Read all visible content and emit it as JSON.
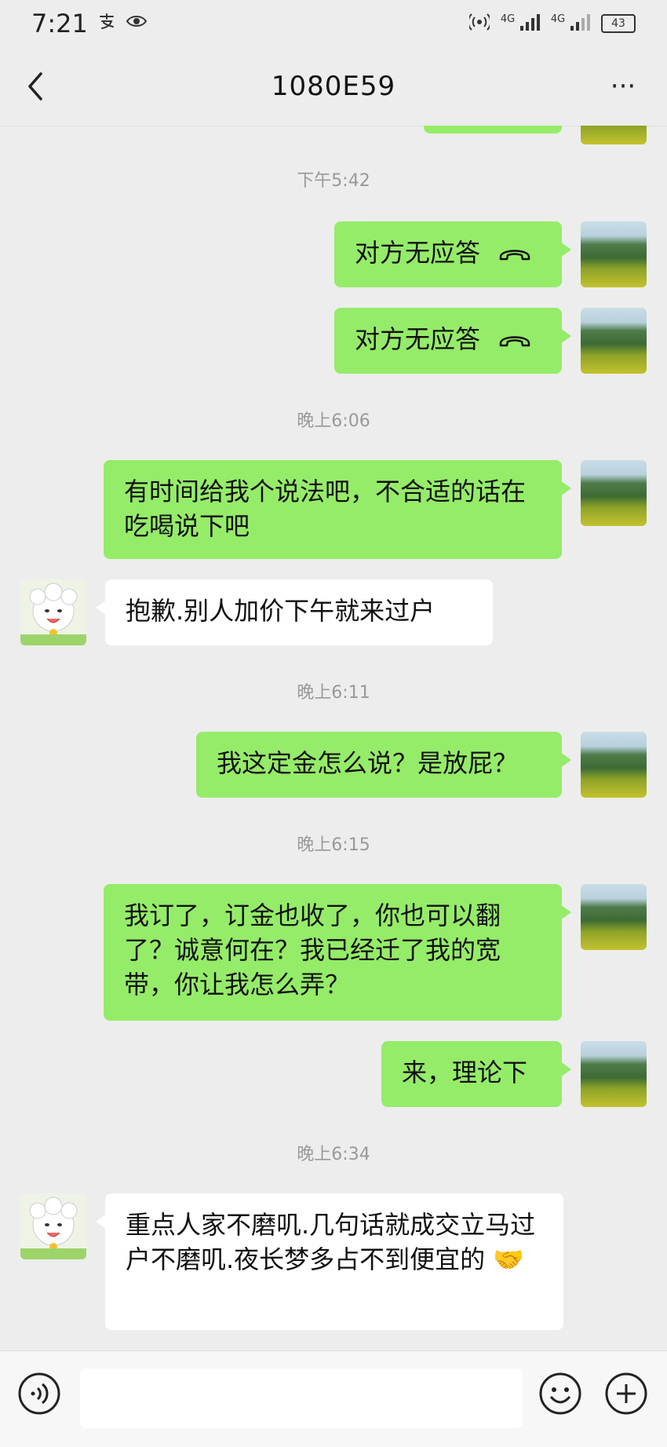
{
  "status_bar": {
    "time": "7:21",
    "left_icons": [
      "alipay-icon",
      "eye-icon"
    ],
    "right_icons": [
      "hotspot-icon",
      "signal-4g-icon",
      "signal-4g-icon"
    ],
    "sim1_label": "4G",
    "sim2_label": "4G",
    "battery": "43"
  },
  "header": {
    "title": "1080E59",
    "back_icon": "chevron-left-icon",
    "more_icon": "more-dots-icon",
    "more_label": "···"
  },
  "chat": {
    "messages": [
      {
        "type": "time",
        "text": "下午5:42"
      },
      {
        "type": "msg",
        "side": "sent",
        "text": "对方无应答",
        "icon": "hangup-icon"
      },
      {
        "type": "msg",
        "side": "sent",
        "text": "对方无应答",
        "icon": "hangup-icon"
      },
      {
        "type": "time",
        "text": "晚上6:06"
      },
      {
        "type": "msg",
        "side": "sent",
        "text": "有时间给我个说法吧，不合适的话在吃喝说下吧"
      },
      {
        "type": "msg",
        "side": "recv",
        "text": "抱歉.别人加价下午就来过户"
      },
      {
        "type": "time",
        "text": "晚上6:11"
      },
      {
        "type": "msg",
        "side": "sent",
        "text": "我这定金怎么说？是放屁？"
      },
      {
        "type": "time",
        "text": "晚上6:15"
      },
      {
        "type": "msg",
        "side": "sent",
        "text": "我订了，订金也收了，你也可以翻了？诚意何在？我已经迁了我的宽带，你让我怎么弄？"
      },
      {
        "type": "msg",
        "side": "sent",
        "text": "来，理论下"
      },
      {
        "type": "time",
        "text": "晚上6:34"
      },
      {
        "type": "msg",
        "side": "recv",
        "text": "重点人家不磨叽.几句话就成交立马过户不磨叽.夜长梦多占不到便宜的",
        "emoji": "🤝"
      }
    ]
  },
  "input_bar": {
    "voice_icon": "voice-icon",
    "emoji_icon": "emoji-icon",
    "plus_icon": "plus-icon",
    "text": ""
  },
  "colors": {
    "sent_bubble": "#95ec69",
    "recv_bubble": "#ffffff",
    "background": "#ededed"
  }
}
